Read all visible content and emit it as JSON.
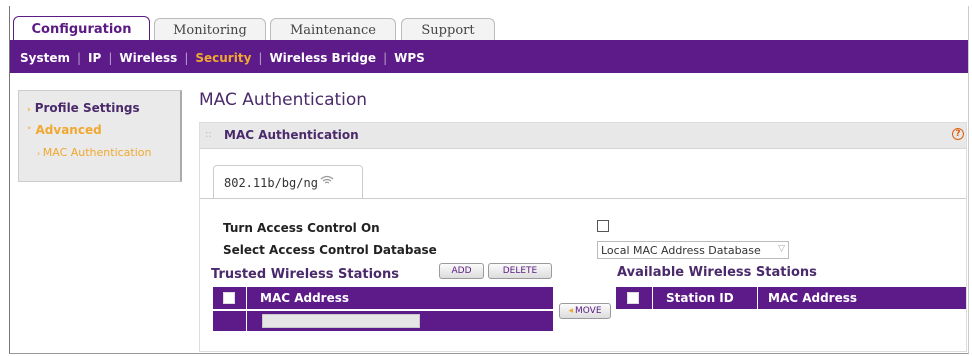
{
  "top_tabs": [
    {
      "label": "Configuration",
      "active": true
    },
    {
      "label": "Monitoring",
      "active": false
    },
    {
      "label": "Maintenance",
      "active": false
    },
    {
      "label": "Support",
      "active": false
    }
  ],
  "subnav": [
    "System",
    "IP",
    "Wireless",
    "Security",
    "Wireless Bridge",
    "WPS"
  ],
  "subnav_active": "Security",
  "sidebar": {
    "profile_settings": "Profile Settings",
    "advanced": "Advanced",
    "mac_auth_link": "MAC Authentication"
  },
  "page_title": "MAC Authentication",
  "section_title": "MAC Authentication",
  "help_icon": "?",
  "radio_tab": "802.11b/bg/ng",
  "form": {
    "access_control_label": "Turn Access Control On",
    "database_label": "Select Access Control Database",
    "database_value": "Local MAC Address Database"
  },
  "trusted": {
    "title": "Trusted Wireless Stations",
    "add_label": "ADD",
    "delete_label": "DELETE",
    "col_mac": "MAC Address"
  },
  "move_label": "MOVE",
  "available": {
    "title": "Available Wireless Stations",
    "col_station": "Station ID",
    "col_mac": "MAC Address"
  },
  "colors": {
    "brand_purple": "#5d1a89",
    "accent_orange": "#f0a830"
  }
}
